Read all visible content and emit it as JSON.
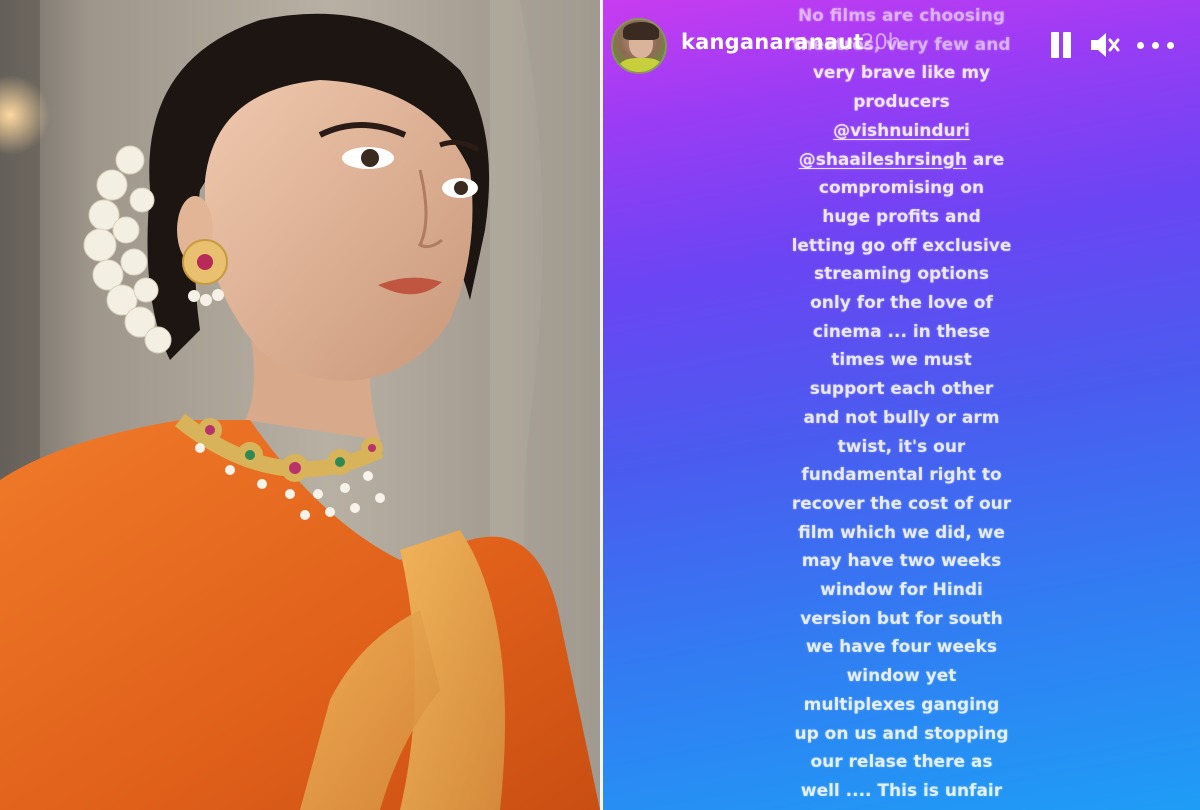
{
  "story": {
    "username": "kanganaranaut",
    "time": "20h",
    "lines": [
      "No films are choosing",
      "theatres, very few and",
      "very brave like my",
      "producers",
      "@vishnuinduri",
      "@shaaileshrsingh are",
      "compromising on",
      "huge profits and",
      "letting go off exclusive",
      "streaming options",
      "only for the love of",
      "cinema ... in these",
      "times we must",
      "support each other",
      "and not bully or arm",
      "twist, it's our",
      "fundamental right to",
      "recover the cost of our",
      "film which we did, we",
      "may have two weeks",
      "window for Hindi",
      "version but for south",
      "we have four weeks",
      "window yet",
      "multiplexes ganging",
      "up on us and stopping",
      "our relase there as",
      "well .... This is unfair"
    ],
    "colors": {
      "gradient_top": "#c83cf0",
      "gradient_mid": "#4a5cf0",
      "gradient_bottom": "#1e9df6"
    }
  },
  "controls": {
    "pause_icon": "pause-icon",
    "mute_icon": "speaker-muted-icon",
    "more_icon": "more-horizontal-icon"
  },
  "photo": {
    "subject": "woman-in-orange-saree-portrait",
    "colors": {
      "saree": "#e8671f",
      "border": "#e4a44a",
      "flowers": "#f3efe2"
    }
  }
}
